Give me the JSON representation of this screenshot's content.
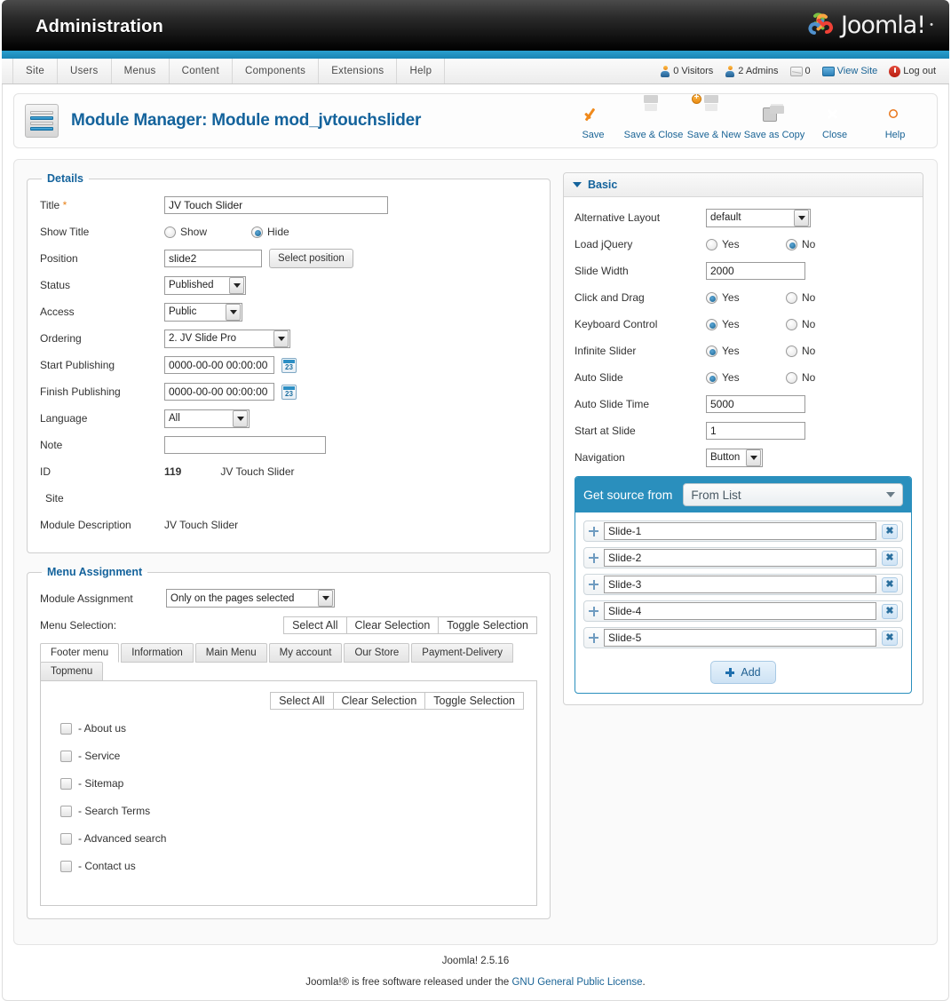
{
  "header": {
    "admin_title": "Administration",
    "brand": "Joomla!",
    "brand_dot": "®"
  },
  "menubar": {
    "items": [
      {
        "label": "Site"
      },
      {
        "label": "Users"
      },
      {
        "label": "Menus"
      },
      {
        "label": "Content"
      },
      {
        "label": "Components"
      },
      {
        "label": "Extensions"
      },
      {
        "label": "Help"
      }
    ],
    "status": {
      "visitors": "0 Visitors",
      "admins": "2 Admins",
      "messages": "0",
      "view_site": "View Site",
      "logout": "Log out"
    }
  },
  "page": {
    "title": "Module Manager: Module mod_jvtouchslider"
  },
  "toolbar": {
    "buttons": [
      {
        "label": "Save",
        "icon": "check-icon"
      },
      {
        "label": "Save & Close",
        "icon": "floppy-icon"
      },
      {
        "label": "Save & New",
        "icon": "floppy-plus-icon"
      },
      {
        "label": "Save as Copy",
        "icon": "floppy-copy-icon"
      },
      {
        "label": "Close",
        "icon": "close-circle-icon"
      },
      {
        "label": "Help",
        "icon": "lifering-icon"
      }
    ]
  },
  "details": {
    "legend": "Details",
    "title_label": "Title",
    "title_required_mark": "*",
    "title_value": "JV Touch Slider",
    "show_title_label": "Show Title",
    "show_title_options": [
      {
        "label": "Show",
        "selected": false
      },
      {
        "label": "Hide",
        "selected": true
      }
    ],
    "position_label": "Position",
    "position_value": "slide2",
    "select_position_button": "Select position",
    "status_label": "Status",
    "status_value": "Published",
    "access_label": "Access",
    "access_value": "Public",
    "ordering_label": "Ordering",
    "ordering_value": "2. JV Slide Pro",
    "start_publishing_label": "Start Publishing",
    "start_publishing_value": "0000-00-00 00:00:00",
    "finish_publishing_label": "Finish Publishing",
    "finish_publishing_value": "0000-00-00 00:00:00",
    "language_label": "Language",
    "language_value": "All",
    "note_label": "Note",
    "note_value": "",
    "id_label": "ID",
    "id_value": "119",
    "id_module_name": "JV Touch Slider",
    "site_label": "Site",
    "module_description_label": "Module Description",
    "module_description_value": "JV Touch Slider"
  },
  "menu_assignment": {
    "legend": "Menu Assignment",
    "module_assignment_label": "Module Assignment",
    "module_assignment_value": "Only on the pages selected",
    "menu_selection_label": "Menu Selection:",
    "selection_buttons": [
      "Select All",
      "Clear Selection",
      "Toggle Selection"
    ],
    "tabs": [
      {
        "label": "Footer menu",
        "active": true
      },
      {
        "label": "Information",
        "active": false
      },
      {
        "label": "Main Menu",
        "active": false
      },
      {
        "label": "My account",
        "active": false
      },
      {
        "label": "Our Store",
        "active": false
      },
      {
        "label": "Payment-Delivery",
        "active": false
      },
      {
        "label": "Topmenu",
        "active": false
      }
    ],
    "panel_buttons": [
      "Select All",
      "Clear Selection",
      "Toggle Selection"
    ],
    "items": [
      {
        "label": "- About us",
        "checked": false
      },
      {
        "label": "- Service",
        "checked": false
      },
      {
        "label": "- Sitemap",
        "checked": false
      },
      {
        "label": "- Search Terms",
        "checked": false
      },
      {
        "label": "- Advanced search",
        "checked": false
      },
      {
        "label": "- Contact us",
        "checked": false
      }
    ]
  },
  "basic": {
    "title": "Basic",
    "alternative_layout_label": "Alternative Layout",
    "alternative_layout_value": "default",
    "load_jquery_label": "Load jQuery",
    "load_jquery_yes": "Yes",
    "load_jquery_no": "No",
    "load_jquery_selected": "No",
    "slide_width_label": "Slide Width",
    "slide_width_value": "2000",
    "click_and_drag_label": "Click and Drag",
    "click_and_drag_selected": "Yes",
    "keyboard_control_label": "Keyboard Control",
    "keyboard_control_selected": "Yes",
    "infinite_slider_label": "Infinite Slider",
    "infinite_slider_selected": "Yes",
    "auto_slide_label": "Auto Slide",
    "auto_slide_selected": "Yes",
    "auto_slide_time_label": "Auto Slide Time",
    "auto_slide_time_value": "5000",
    "start_at_slide_label": "Start at Slide",
    "start_at_slide_value": "1",
    "navigation_label": "Navigation",
    "navigation_value": "Button",
    "yes_label": "Yes",
    "no_label": "No",
    "source": {
      "label": "Get source from",
      "value": "From List",
      "slides": [
        {
          "name": "Slide-1"
        },
        {
          "name": "Slide-2"
        },
        {
          "name": "Slide-3"
        },
        {
          "name": "Slide-4"
        },
        {
          "name": "Slide-5"
        }
      ],
      "add_label": "Add"
    }
  },
  "footer": {
    "version": "Joomla! 2.5.16",
    "license_prefix": "Joomla!® is free software released under the ",
    "license_link": "GNU General Public License",
    "license_suffix": "."
  },
  "colors": {
    "accent_blue": "#1a84b4",
    "link_blue": "#1a6496",
    "title_blue": "#14639c",
    "source_blue": "#2a8fbd",
    "required_orange": "#e8821a"
  }
}
